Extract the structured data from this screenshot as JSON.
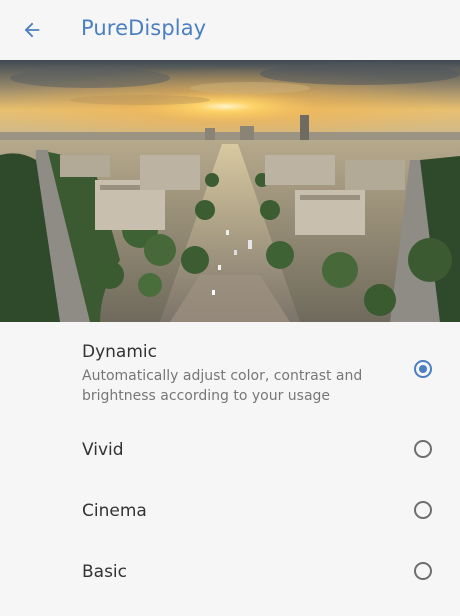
{
  "app_bar": {
    "title": "PureDisplay",
    "back_icon": "arrow-left-icon"
  },
  "preview": {
    "description_icon": "city-avenue-sunset-image"
  },
  "colors": {
    "accent": "#4a7fc1",
    "background": "#f6f6f6",
    "title_text": "#333333",
    "secondary_text": "#777777"
  },
  "options": [
    {
      "title": "Dynamic",
      "description": "Automatically adjust color, contrast and brightness according to your usage",
      "selected": true
    },
    {
      "title": "Vivid",
      "description": "",
      "selected": false
    },
    {
      "title": "Cinema",
      "description": "",
      "selected": false
    },
    {
      "title": "Basic",
      "description": "",
      "selected": false
    }
  ]
}
